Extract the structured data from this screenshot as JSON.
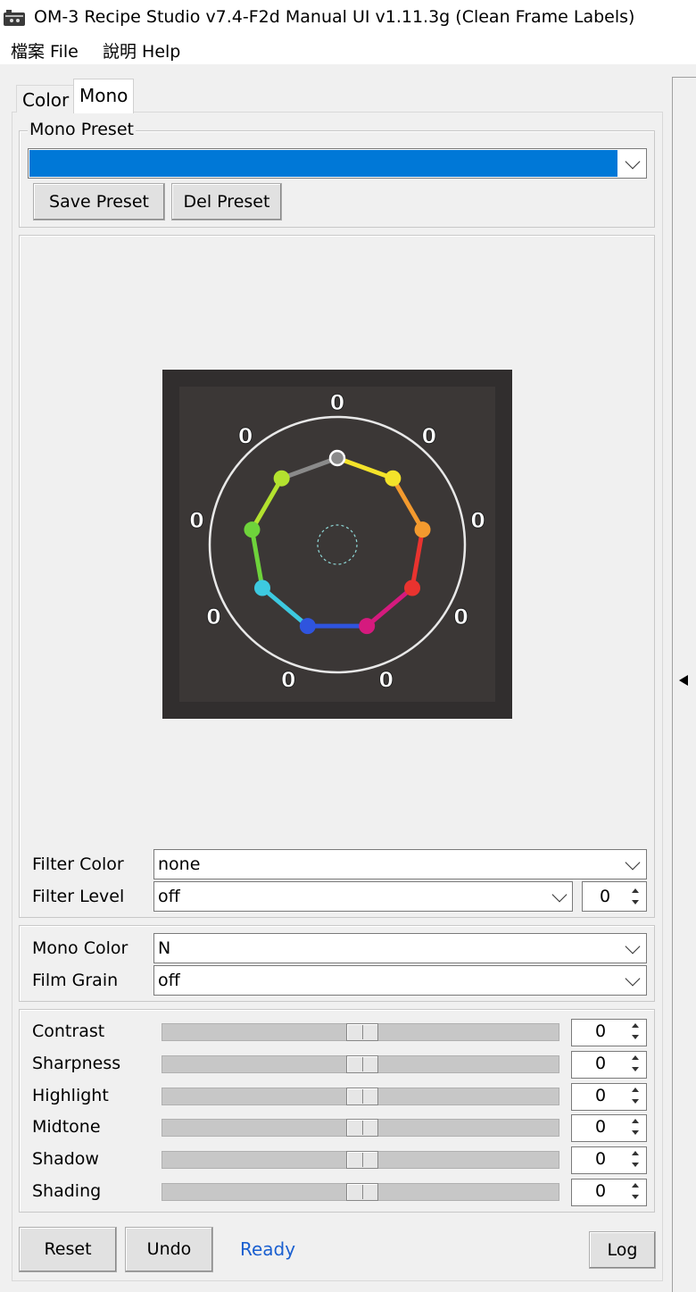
{
  "window": {
    "title": "OM-3 Recipe Studio v7.4-F2d Manual UI v1.11.3g (Clean Frame Labels)"
  },
  "menu": {
    "items": [
      "檔案 File",
      "說明 Help"
    ]
  },
  "tabs": [
    {
      "label": "Color",
      "active": false
    },
    {
      "label": "Mono",
      "active": true
    }
  ],
  "preset": {
    "group_label": "Mono Preset",
    "selected": "",
    "save_label": "Save Preset",
    "delete_label": "Del Preset"
  },
  "color_wheel": {
    "nodes": [
      {
        "name": "gray",
        "color": "#8a8a8a",
        "value": "0"
      },
      {
        "name": "yellow",
        "color": "#f4e32a",
        "value": "0"
      },
      {
        "name": "orange",
        "color": "#f39a2e",
        "value": "0"
      },
      {
        "name": "red",
        "color": "#e9332f",
        "value": "0"
      },
      {
        "name": "magenta",
        "color": "#d51a7e",
        "value": "0"
      },
      {
        "name": "blue",
        "color": "#2f54de",
        "value": "0"
      },
      {
        "name": "cyan",
        "color": "#3dc9e0",
        "value": "0"
      },
      {
        "name": "green",
        "color": "#6ed33b",
        "value": "0"
      },
      {
        "name": "lime",
        "color": "#b3e22f",
        "value": "0"
      }
    ]
  },
  "filter": {
    "color_label": "Filter Color",
    "color_value": "none",
    "level_label": "Filter Level",
    "level_value": "off",
    "level_number": "0"
  },
  "mono": {
    "color_label": "Mono Color",
    "color_value": "N",
    "grain_label": "Film Grain",
    "grain_value": "off"
  },
  "sliders": [
    {
      "label": "Contrast",
      "value": "0",
      "position": 0.5
    },
    {
      "label": "Sharpness",
      "value": "0",
      "position": 0.5
    },
    {
      "label": "Highlight",
      "value": "0",
      "position": 0.5
    },
    {
      "label": "Midtone",
      "value": "0",
      "position": 0.5
    },
    {
      "label": "Shadow",
      "value": "0",
      "position": 0.5
    },
    {
      "label": "Shading",
      "value": "0",
      "position": 0.5
    }
  ],
  "footer": {
    "reset_label": "Reset",
    "undo_label": "Undo",
    "status": "Ready",
    "log_label": "Log"
  }
}
